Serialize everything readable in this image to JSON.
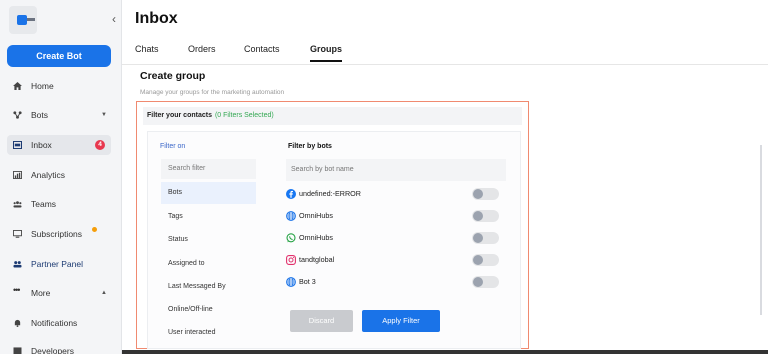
{
  "sidebar": {
    "create_bot": "Create Bot",
    "items": [
      {
        "label": "Home",
        "icon": "home-icon"
      },
      {
        "label": "Bots",
        "icon": "bots-icon"
      },
      {
        "label": "Inbox",
        "icon": "inbox-icon",
        "badge": "4"
      },
      {
        "label": "Analytics",
        "icon": "analytics-icon"
      },
      {
        "label": "Teams",
        "icon": "teams-icon"
      },
      {
        "label": "Subscriptions",
        "icon": "subscriptions-icon"
      },
      {
        "label": "Partner Panel",
        "icon": "partner-icon"
      },
      {
        "label": "More",
        "icon": "more-icon"
      },
      {
        "label": "Notifications",
        "icon": "bell-icon"
      },
      {
        "label": "Developers",
        "icon": "developers-icon"
      }
    ]
  },
  "header": {
    "title": "Inbox"
  },
  "tabs": [
    "Chats",
    "Orders",
    "Contacts",
    "Groups"
  ],
  "active_tab": "Groups",
  "section": {
    "title": "Create group",
    "subtitle": "Manage your groups for the marketing automation"
  },
  "panel": {
    "title": "Filter your contacts",
    "count": "(0 Filters Selected)",
    "filter_on": "Filter on",
    "search_filter": "Search filter",
    "filters": [
      "Bots",
      "Tags",
      "Status",
      "Assigned to",
      "Last Messaged By",
      "Online/Off-line",
      "User interacted"
    ],
    "filter_by_bots": "Filter by bots",
    "search_bot_placeholder": "Search by bot name",
    "bots": [
      {
        "name": "undefined:-ERROR",
        "icon": "facebook-icon"
      },
      {
        "name": "OmniHubs",
        "icon": "globe-icon"
      },
      {
        "name": "OmniHubs",
        "icon": "whatsapp-icon"
      },
      {
        "name": "tandtglobal",
        "icon": "instagram-icon"
      },
      {
        "name": "Bot 3",
        "icon": "globe-icon"
      }
    ],
    "discard": "Discard",
    "apply": "Apply Filter"
  },
  "colors": {
    "accent": "#1a73e8",
    "badge": "#e8384f",
    "success": "#34a853",
    "panel_border": "#f08a70"
  }
}
